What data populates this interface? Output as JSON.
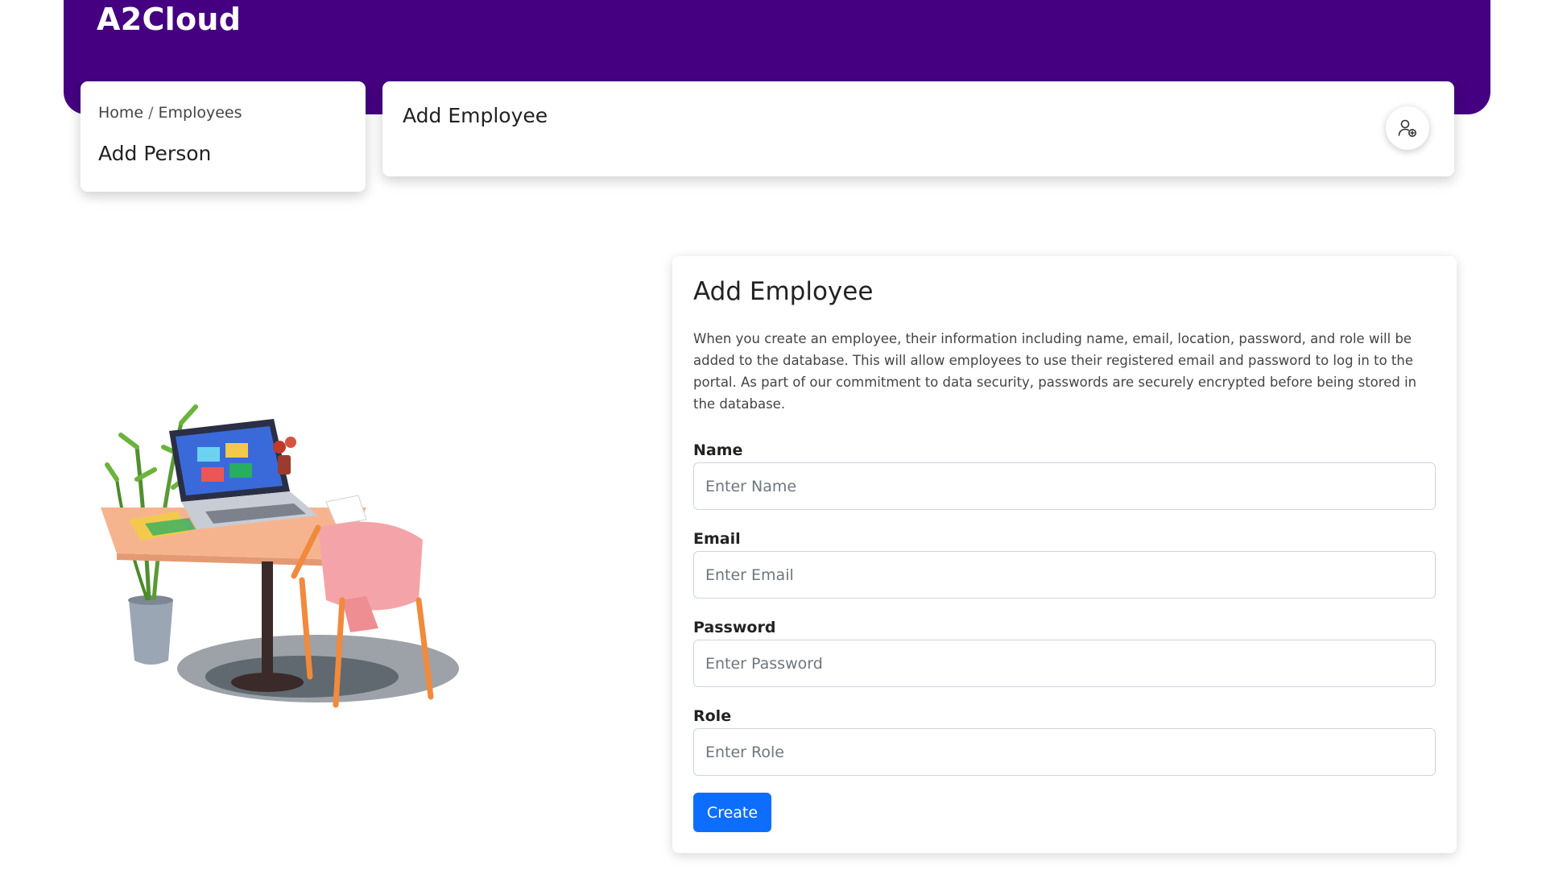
{
  "app": {
    "brand": "A2Cloud"
  },
  "breadcrumb": {
    "home": "Home",
    "separator": "/",
    "current": "Employees"
  },
  "sidebar_card": {
    "title": "Add Person"
  },
  "header_card": {
    "title": "Add Employee",
    "icon": "user-plus-icon"
  },
  "illustration": {
    "icon": "desk-workspace-illustration"
  },
  "form": {
    "title": "Add Employee",
    "description": "When you create an employee, their information including name, email, location, password, and role will be added to the database. This will allow employees to use their registered email and password to log in to the portal. As part of our commitment to data security, passwords are securely encrypted before being stored in the database.",
    "fields": {
      "name": {
        "label": "Name",
        "placeholder": "Enter Name",
        "value": ""
      },
      "email": {
        "label": "Email",
        "placeholder": "Enter Email",
        "value": ""
      },
      "password": {
        "label": "Password",
        "placeholder": "Enter Password",
        "value": ""
      },
      "role": {
        "label": "Role",
        "placeholder": "Enter Role",
        "value": ""
      }
    },
    "submit_label": "Create"
  },
  "colors": {
    "brand_purple": "#450081",
    "primary_button": "#0d6efd",
    "page_background": "#ffffff"
  }
}
